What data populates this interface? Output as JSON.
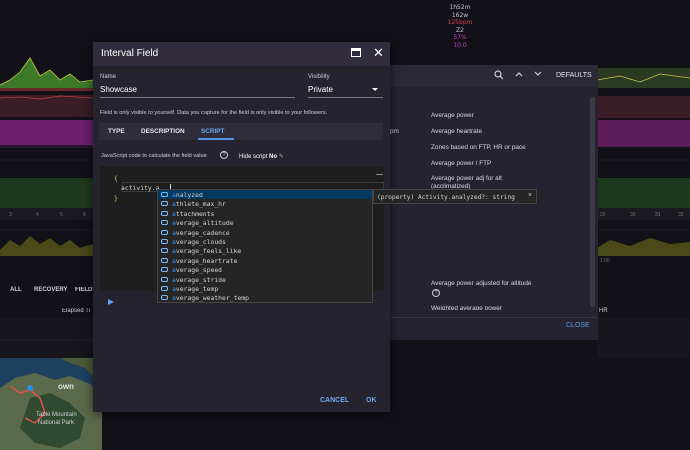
{
  "stats": [
    "1h52m",
    "162w",
    "125bpm",
    "Z2",
    "57%",
    "10.0"
  ],
  "background": {
    "defaults": "DEFAULTS",
    "items": [
      "Average power",
      "Average heartrate",
      "Zones based on FTP, HR or pace",
      "Average power / FTP",
      "Average power adj for alt",
      "(acclimatized)",
      "Average power adjusted for altitude",
      "Weighted average power"
    ],
    "close": "CLOSE",
    "left_tabs": [
      "ALL",
      "RECOVERY",
      "FIELDS"
    ],
    "elapsed": "Elapsed Ti",
    "bpm": "pm",
    "hr": "g HR",
    "axis_left": [
      "3",
      "4",
      "5",
      "6"
    ],
    "axis_right": [
      "29",
      "30",
      "31",
      "32"
    ],
    "axis_small": "1:00",
    "map_labels": [
      "Table Mountain",
      "National Park",
      "own"
    ]
  },
  "dialog": {
    "title": "Interval Field",
    "name_label": "Name",
    "name_value": "Showcase",
    "visibility_label": "Visibility",
    "visibility_value": "Private",
    "note": "Field is only visible to yourself. Data you capture for the field is only visible to your followers.",
    "tabs": [
      "TYPE",
      "DESCRIPTION",
      "SCRIPT"
    ],
    "hint": "JavaScript code to calculate the field value",
    "help": "?",
    "hide_script_label": "Hide script",
    "hide_script_value": "No",
    "code_lines": [
      "{",
      "activity.a",
      "}"
    ],
    "cancel": "CANCEL",
    "ok": "OK"
  },
  "autocomplete": {
    "prefix": "a",
    "items": [
      "analyzed",
      "athlete_max_hr",
      "attachments",
      "average_altitude",
      "average_cadence",
      "average_clouds",
      "average_feels_like",
      "average_heartrate",
      "average_speed",
      "average_stride",
      "average_temp",
      "average_weather_temp"
    ],
    "detail": "(property) Activity.analyzed?: string",
    "detail_close": "×"
  },
  "colors": {
    "accent": "#4f95e3",
    "dialog_bg": "#25232e",
    "title_bar": "#302c3e"
  }
}
